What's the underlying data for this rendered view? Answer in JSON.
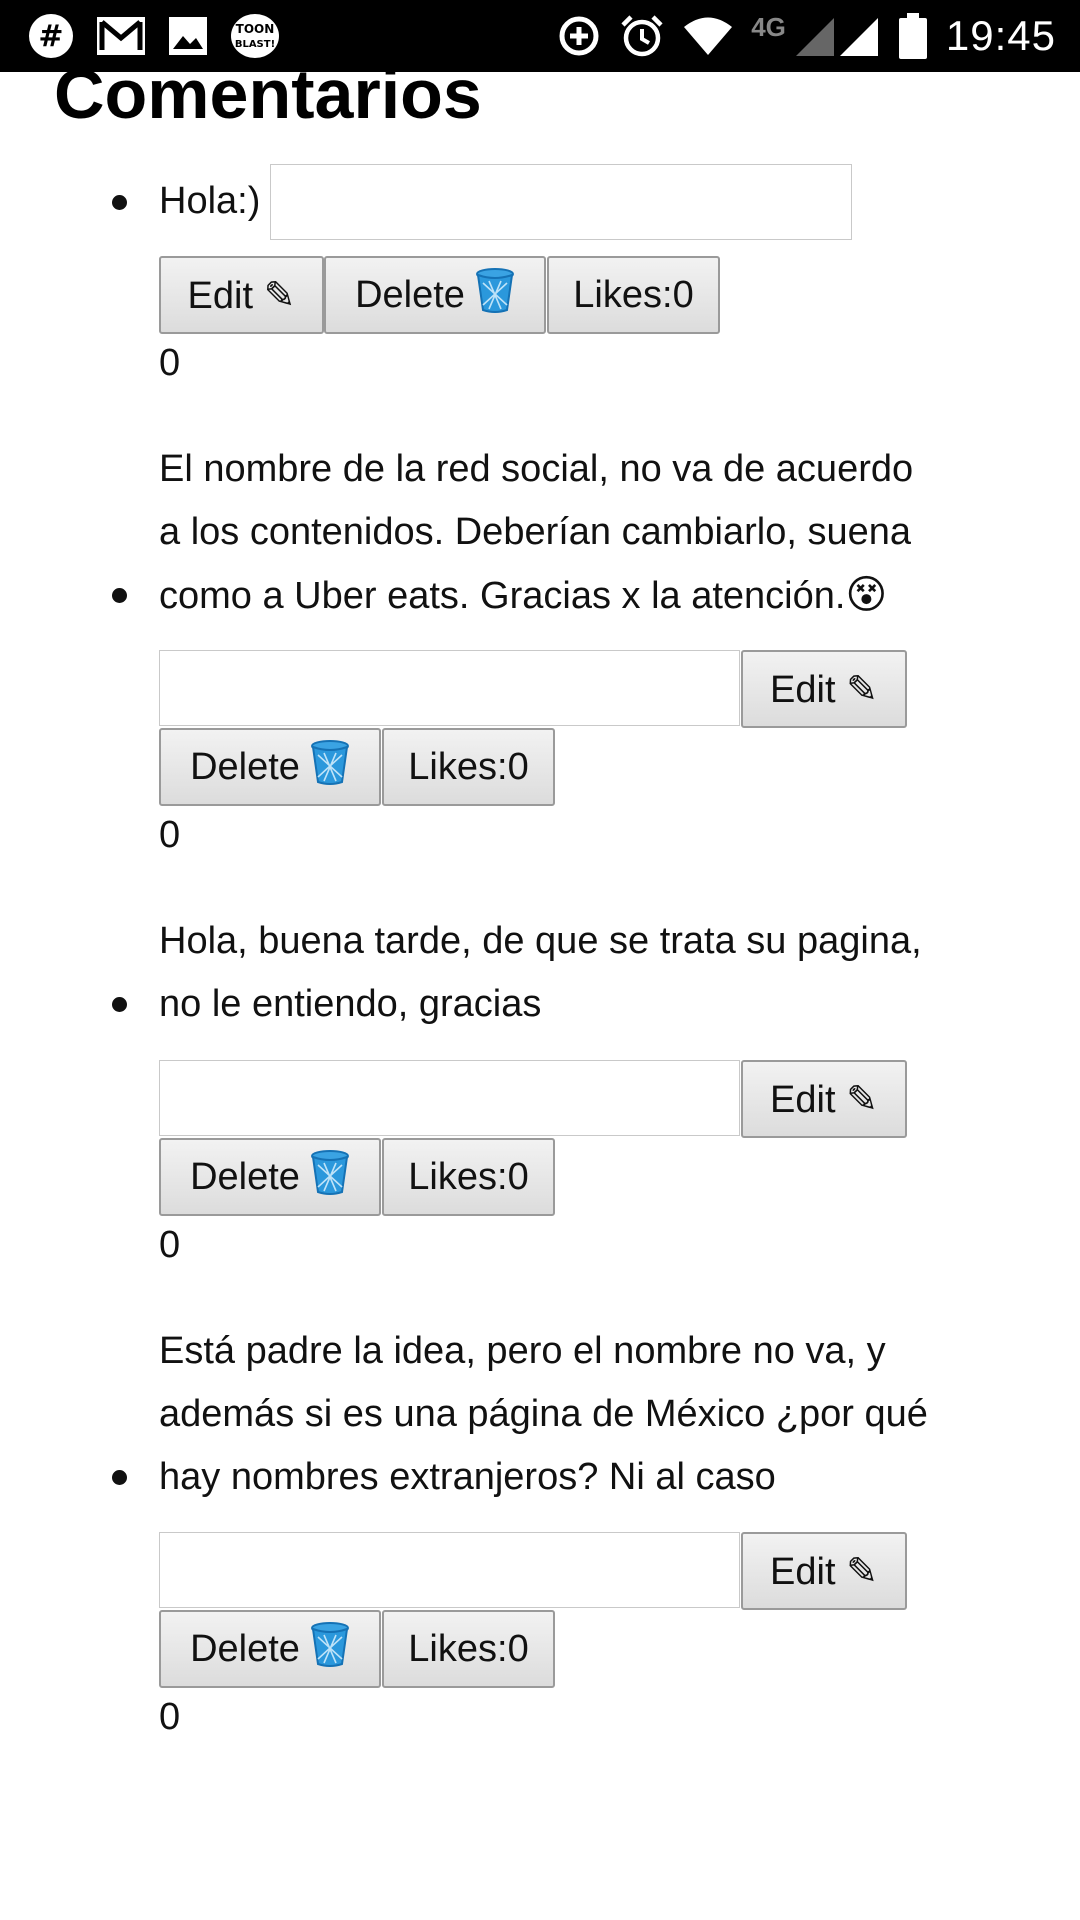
{
  "status_bar": {
    "time": "19:45",
    "network": "4G",
    "left_icons": [
      "slack-icon",
      "gmail-icon",
      "image-icon",
      "toon-blast-icon"
    ],
    "right_icons": [
      "data-saver-icon",
      "alarm-icon",
      "wifi-icon",
      "signal-icon",
      "battery-icon"
    ]
  },
  "page": {
    "title": "Comentarios"
  },
  "comments": [
    {
      "text": "Hola:)",
      "input_value": "",
      "edit_label": "Edit ✎",
      "delete_label": "Delete",
      "likes_label": "Likes:0",
      "likes_count": "0"
    },
    {
      "text_lines": [
        "El nombre de la red social, no va de acuerdo",
        "a los contenidos. Deberían cambiarlo, suena",
        "como a Uber eats. Gracias x la atención."
      ],
      "emoji": "😵",
      "input_value": "",
      "edit_label": "Edit ✎",
      "delete_label": "Delete",
      "likes_label": "Likes:0",
      "likes_count": "0"
    },
    {
      "text_lines": [
        "Hola, buena tarde, de que se trata su pagina,",
        "no le entiendo, gracias"
      ],
      "input_value": "",
      "edit_label": "Edit ✎",
      "delete_label": "Delete",
      "likes_label": "Likes:0",
      "likes_count": "0"
    },
    {
      "text_lines": [
        "Está padre la idea, pero el nombre no va, y",
        "además si es una página de México ¿por qué",
        "hay nombres extranjeros? Ni al caso"
      ],
      "input_value": "",
      "edit_label": "Edit ✎",
      "delete_label": "Delete",
      "likes_label": "Likes:0",
      "likes_count": "0"
    }
  ],
  "colors": {
    "status_bar_bg": "#000000",
    "button_bg": "#e4e4e4",
    "trash_blue": "#1e8fd8"
  }
}
